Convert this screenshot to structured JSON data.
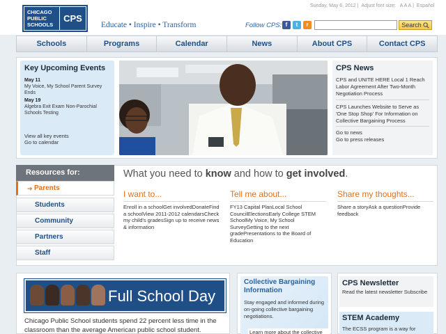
{
  "header": {
    "logo_left": "CHICAGO PUBLIC SCHOOLS",
    "logo_right": "CPS",
    "tagline": "Educate • Inspire • Transform",
    "date": "Sunday, May 6, 2012",
    "font_size_label": "Adjust font size:",
    "font_size_options": "A A A",
    "espanol": "Español",
    "follow_label": "Follow CPS:",
    "social": {
      "facebook": "f",
      "twitter": "t",
      "rss": "r"
    },
    "search": {
      "placeholder": "",
      "button_label": "Search"
    }
  },
  "nav": {
    "items": [
      "Schools",
      "Programs",
      "Calendar",
      "News",
      "About CPS",
      "Contact CPS"
    ]
  },
  "events": {
    "title": "Key Upcoming Events",
    "items": [
      {
        "date": "May 11",
        "text": "My Voice, My School Parent Survey Ends"
      },
      {
        "date": "May 19",
        "text": "Algebra Exit Exam Non-Parochial Schools Testing"
      }
    ],
    "view_all": "View all key events",
    "go_calendar": "Go to calendar"
  },
  "news": {
    "title": "CPS News",
    "items": [
      "CPS and UNITE HERE Local 1 Reach Labor Agreement After Two-Month Negotiation Process",
      "CPS Launches Website to Serve as 'One Stop Shop' For Information on Collective Bargaining Process"
    ],
    "go_news": "Go to news",
    "go_press": "Go to press releases"
  },
  "resources": {
    "title": "Resources for:",
    "items": [
      "Parents",
      "Students",
      "Community",
      "Partners",
      "Staff"
    ],
    "active": "Parents"
  },
  "know": {
    "prefix": "What you need to ",
    "know": "know",
    "middle": " and how to ",
    "involved": "get involved",
    "suffix": "."
  },
  "columns": [
    {
      "title": "I want to...",
      "text": "Enroll in a schoolGet involvedDonateFind a schoolView 2011-2012 calendarsCheck my child's gradesSign up to receive news & information"
    },
    {
      "title": "Tell me about...",
      "text": "FY13 Capital PlanLocal School CouncilElectionsEarly College STEM SchoolMy Voice, My School SurveyGetting to the next gradePresentations to the Board of Education"
    },
    {
      "title": "Share my thoughts...",
      "text": "Share a storyAsk a questionProvide feedback"
    }
  ],
  "fullday": {
    "banner": "Full School Day",
    "text": "Chicago Public School students spend 22 percent less time in the classroom than the average American public school student."
  },
  "collective": {
    "title": "Collective Bargaining Information",
    "text": "Stay engaged and informed during on-going collective bargaining negotiations.",
    "more": "Learn more about the collective"
  },
  "newsletter": {
    "title": "CPS Newsletter",
    "text": "Read the latest newsletter Subscribe"
  },
  "stem": {
    "title": "STEM Academy",
    "text": "The ECSS program is a way for"
  },
  "colors": {
    "brand_blue": "#1f4f86",
    "link_blue": "#2a62a3",
    "accent_orange": "#e0711d"
  }
}
